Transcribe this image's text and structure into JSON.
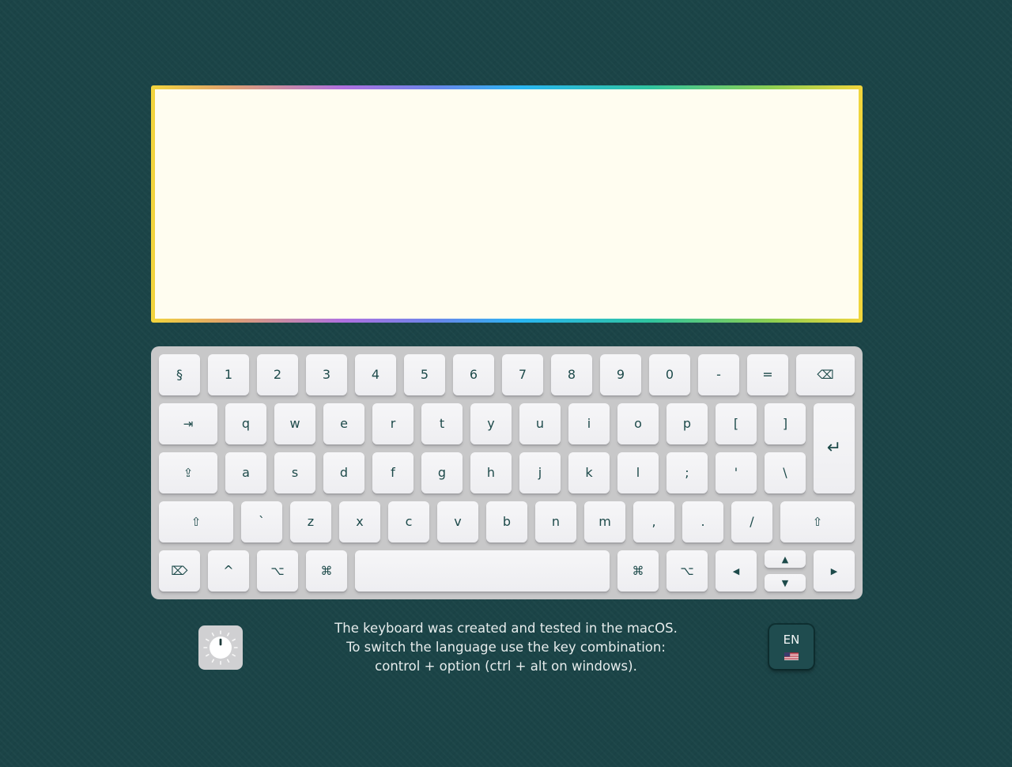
{
  "editor": {
    "value": "",
    "placeholder": ""
  },
  "keyboard": {
    "row1": [
      "§",
      "1",
      "2",
      "3",
      "4",
      "5",
      "6",
      "7",
      "8",
      "9",
      "0",
      "-",
      "=",
      "⌫"
    ],
    "row2": [
      "⇥",
      "q",
      "w",
      "e",
      "r",
      "t",
      "y",
      "u",
      "i",
      "o",
      "p",
      "[",
      "]"
    ],
    "enter": "↵",
    "row3": [
      "⇪",
      "a",
      "s",
      "d",
      "f",
      "g",
      "h",
      "j",
      "k",
      "l",
      ";",
      "'",
      "\\"
    ],
    "row4": [
      "⇧",
      "`",
      "z",
      "x",
      "c",
      "v",
      "b",
      "n",
      "m",
      ",",
      ".",
      "/",
      "⇧"
    ],
    "row5": {
      "delete": "⌦",
      "control": "^",
      "option_left": "⌥",
      "command_left": "⌘",
      "space": "",
      "command_right": "⌘",
      "option_right": "⌥",
      "arrow_left": "◀",
      "arrow_up": "▲",
      "arrow_down": "▼",
      "arrow_right": "▶"
    }
  },
  "info": {
    "line1": "The keyboard was created and tested in the macOS.",
    "line2": "To switch the language use the key combination:",
    "line3": "control + option (ctrl + alt on windows)."
  },
  "language": {
    "code": "EN",
    "flag_icon": "us-flag-icon"
  },
  "brightness_icon": "brightness-knob-icon"
}
